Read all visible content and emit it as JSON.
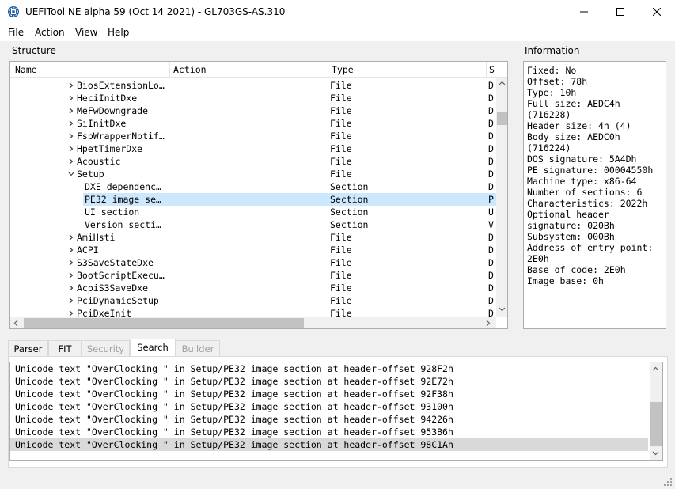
{
  "window": {
    "title": "UEFITool NE alpha 59 (Oct 14 2021) - GL703GS-AS.310"
  },
  "menu": [
    "File",
    "Action",
    "View",
    "Help"
  ],
  "structure": {
    "label": "Structure",
    "columns": [
      "Name",
      "Action",
      "Type",
      "S"
    ],
    "rows": [
      {
        "name": "BiosExtensionLo…",
        "type": "File",
        "sub": "D",
        "depth": 0,
        "chevron": "right",
        "selected": false
      },
      {
        "name": "HeciInitDxe",
        "type": "File",
        "sub": "D",
        "depth": 0,
        "chevron": "right",
        "selected": false
      },
      {
        "name": "MeFwDowngrade",
        "type": "File",
        "sub": "D",
        "depth": 0,
        "chevron": "right",
        "selected": false
      },
      {
        "name": "SiInitDxe",
        "type": "File",
        "sub": "D",
        "depth": 0,
        "chevron": "right",
        "selected": false
      },
      {
        "name": "FspWrapperNotif…",
        "type": "File",
        "sub": "D",
        "depth": 0,
        "chevron": "right",
        "selected": false
      },
      {
        "name": "HpetTimerDxe",
        "type": "File",
        "sub": "D",
        "depth": 0,
        "chevron": "right",
        "selected": false
      },
      {
        "name": "Acoustic",
        "type": "File",
        "sub": "D",
        "depth": 0,
        "chevron": "right",
        "selected": false
      },
      {
        "name": "Setup",
        "type": "File",
        "sub": "D",
        "depth": 0,
        "chevron": "down",
        "selected": false
      },
      {
        "name": "DXE dependenc…",
        "type": "Section",
        "sub": "D",
        "depth": 1,
        "chevron": "none",
        "selected": false
      },
      {
        "name": "PE32 image se…",
        "type": "Section",
        "sub": "P",
        "depth": 1,
        "chevron": "none",
        "selected": true
      },
      {
        "name": "UI section",
        "type": "Section",
        "sub": "U",
        "depth": 1,
        "chevron": "none",
        "selected": false
      },
      {
        "name": "Version secti…",
        "type": "Section",
        "sub": "V",
        "depth": 1,
        "chevron": "none",
        "selected": false
      },
      {
        "name": "AmiHsti",
        "type": "File",
        "sub": "D",
        "depth": 0,
        "chevron": "right",
        "selected": false
      },
      {
        "name": "ACPI",
        "type": "File",
        "sub": "D",
        "depth": 0,
        "chevron": "right",
        "selected": false
      },
      {
        "name": "S3SaveStateDxe",
        "type": "File",
        "sub": "D",
        "depth": 0,
        "chevron": "right",
        "selected": false
      },
      {
        "name": "BootScriptExecu…",
        "type": "File",
        "sub": "D",
        "depth": 0,
        "chevron": "right",
        "selected": false
      },
      {
        "name": "AcpiS3SaveDxe",
        "type": "File",
        "sub": "D",
        "depth": 0,
        "chevron": "right",
        "selected": false
      },
      {
        "name": "PciDynamicSetup",
        "type": "File",
        "sub": "D",
        "depth": 0,
        "chevron": "right",
        "selected": false
      },
      {
        "name": "PciDxeInit",
        "type": "File",
        "sub": "D",
        "depth": 0,
        "chevron": "right",
        "selected": false
      }
    ]
  },
  "information": {
    "label": "Information",
    "lines": [
      "Fixed: No",
      "Offset: 78h",
      "Type: 10h",
      "Full size: AEDC4h",
      "(716228)",
      "Header size: 4h (4)",
      "Body size: AEDC0h",
      "(716224)",
      "DOS signature: 5A4Dh",
      "PE signature: 00004550h",
      "Machine type: x86-64",
      "Number of sections: 6",
      "Characteristics: 2022h",
      "Optional header",
      "signature: 020Bh",
      "Subsystem: 000Bh",
      "Address of entry point:",
      "2E0h",
      "Base of code: 2E0h",
      "Image base: 0h"
    ]
  },
  "tabs": [
    {
      "label": "Parser",
      "active": false,
      "disabled": false
    },
    {
      "label": "FIT",
      "active": false,
      "disabled": false
    },
    {
      "label": "Security",
      "active": false,
      "disabled": true
    },
    {
      "label": "Search",
      "active": true,
      "disabled": false
    },
    {
      "label": "Builder",
      "active": false,
      "disabled": true
    }
  ],
  "search_results": [
    {
      "text": "Unicode text \"OverClocking \" in Setup/PE32 image section at header-offset 928F2h",
      "selected": false
    },
    {
      "text": "Unicode text \"OverClocking \" in Setup/PE32 image section at header-offset 92E72h",
      "selected": false
    },
    {
      "text": "Unicode text \"OverClocking \" in Setup/PE32 image section at header-offset 92F38h",
      "selected": false
    },
    {
      "text": "Unicode text \"OverClocking \" in Setup/PE32 image section at header-offset 93100h",
      "selected": false
    },
    {
      "text": "Unicode text \"OverClocking \" in Setup/PE32 image section at header-offset 94226h",
      "selected": false
    },
    {
      "text": "Unicode text \"OverClocking \" in Setup/PE32 image section at header-offset 953B6h",
      "selected": false
    },
    {
      "text": "Unicode text \"OverClocking \" in Setup/PE32 image section at header-offset 98C1Ah",
      "selected": true
    }
  ],
  "colors": {
    "selection": "#cce8ff",
    "list_selection": "#d9d9d9",
    "app_icon": "#1f5fa8"
  }
}
